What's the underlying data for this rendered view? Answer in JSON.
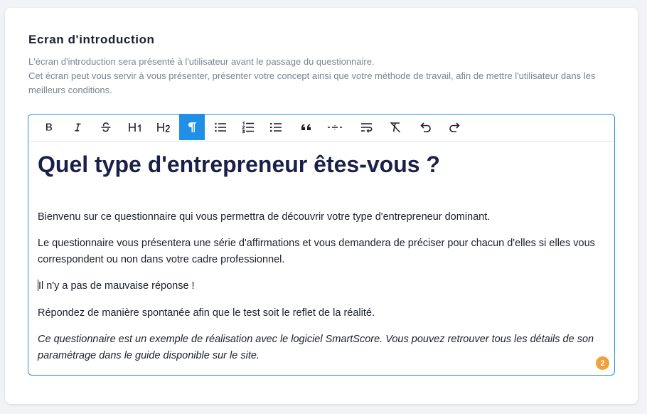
{
  "section": {
    "title": "Ecran d'introduction",
    "description_line1": "L'écran d'introduction sera présenté à l'utilisateur avant le passage du questionnaire.",
    "description_line2": "Cet écran peut vous servir à vous présenter, présenter votre concept ainsi que votre méthode de travail, afin de mettre l'utilisateur dans les meilleurs conditions."
  },
  "toolbar": {
    "buttons": [
      {
        "name": "bold-icon",
        "label": "B"
      },
      {
        "name": "italic-icon",
        "label": "I"
      },
      {
        "name": "strikethrough-icon",
        "label": "S"
      },
      {
        "name": "heading1-icon",
        "label": "H1"
      },
      {
        "name": "heading2-icon",
        "label": "H2"
      },
      {
        "name": "paragraph-icon",
        "label": "¶",
        "active": true
      },
      {
        "name": "bullet-list-icon"
      },
      {
        "name": "ordered-list-icon"
      },
      {
        "name": "task-list-icon"
      },
      {
        "name": "blockquote-icon"
      },
      {
        "name": "horizontal-rule-icon"
      },
      {
        "name": "hard-break-icon"
      },
      {
        "name": "clear-format-icon"
      },
      {
        "name": "undo-icon"
      },
      {
        "name": "redo-icon"
      }
    ],
    "accent_color": "#1e90e8"
  },
  "editor": {
    "heading": "Quel type d'entrepreneur êtes-vous ?",
    "paragraphs": [
      "Bienvenu sur ce questionnaire qui vous permettra de découvrir votre type d'entrepreneur dominant.",
      "Le questionnaire vous présentera une série d'affirmations et vous demandera de préciser pour chacun d'elles si elles vous correspondent ou non dans votre cadre professionnel.",
      "Il n'y a pas de mauvaise réponse !",
      "Répondez de manière spontanée afin que le test soit le reflet de la réalité.",
      "Ce questionnaire est un exemple de réalisation avec le logiciel SmartScore. Vous pouvez retrouver tous les détails de son paramétrage dans le guide disponible sur le site."
    ],
    "badge_count": "2",
    "badge_color": "#f0a23a",
    "border_color": "#2c8fe0"
  }
}
